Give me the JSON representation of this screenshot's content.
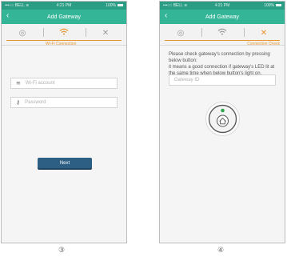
{
  "screen1": {
    "status": {
      "carrier": "BELL",
      "time": "4:21 PM",
      "battery": "100%"
    },
    "title": "Add Gateway",
    "step_label": "Wi-Fi Connection",
    "wifi_placeholder": "Wi-Fi account",
    "password_placeholder": "Password",
    "next_label": "Next",
    "caption": "③"
  },
  "screen2": {
    "status": {
      "carrier": "BELL",
      "time": "4:21 PM",
      "battery": "100%"
    },
    "title": "Add Gateway",
    "step_label": "Connection Check",
    "gateway_placeholder": "Gateway ID",
    "instructions": [
      "Please check gateway's connection by pressing below button:",
      "it means a good connection if gateway's LED lit at the same time when below button's light on."
    ],
    "caption": "④"
  },
  "icons": {
    "back": "chevron-left-icon",
    "step1": "gateway-icon",
    "step2": "wifi-icon",
    "step3": "tools-icon"
  },
  "colors": {
    "status_bar": "#2a9d84",
    "nav_bar": "#34b598",
    "accent": "#e8952d",
    "next_button": "#2c5f83",
    "led": "#2fa84f"
  }
}
